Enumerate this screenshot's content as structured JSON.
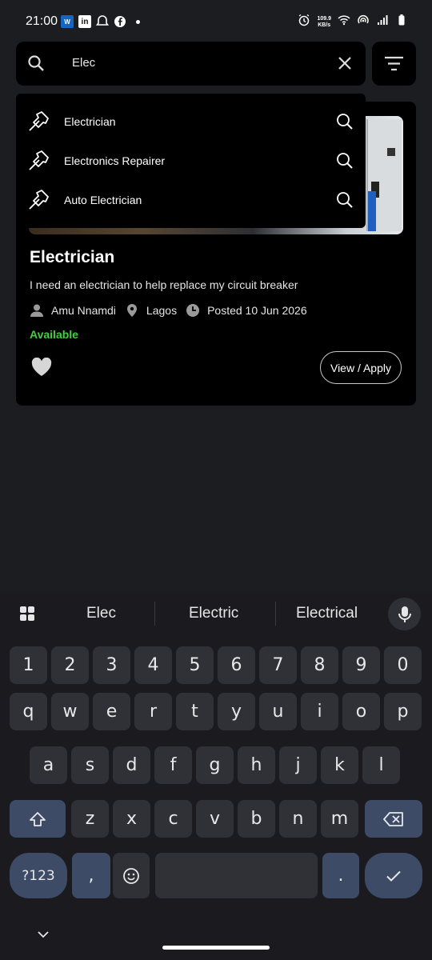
{
  "status_bar": {
    "time": "21:00",
    "speed_line1": "109.9",
    "speed_line2": "KB/s",
    "left_icons": [
      "w-app-icon",
      "linkedin-icon",
      "chat-bubble-icon",
      "facebook-icon"
    ],
    "right_icons": [
      "alarm-icon",
      "wifi-icon",
      "hotspot-icon",
      "signal-icon",
      "battery-icon"
    ]
  },
  "search": {
    "query": "Elec"
  },
  "suggestions": [
    {
      "label": "Electrician",
      "icon": "hammer-icon"
    },
    {
      "label": "Electronics Repairer",
      "icon": "hammer-icon"
    },
    {
      "label": "Auto Electrician",
      "icon": "hammer-icon"
    }
  ],
  "job_card": {
    "title": "Electrician",
    "description": "I need an electrician to help replace my circuit breaker",
    "poster": "Amu Nnamdi",
    "location": "Lagos",
    "posted": "Posted 10 Jun 2026",
    "status": "Available",
    "status_color": "#3fd13f",
    "action_label": "View / Apply"
  },
  "keyboard": {
    "suggestions": [
      "Elec",
      "Electric",
      "Electrical"
    ],
    "row_numbers": [
      "1",
      "2",
      "3",
      "4",
      "5",
      "6",
      "7",
      "8",
      "9",
      "0"
    ],
    "row1": [
      "q",
      "w",
      "e",
      "r",
      "t",
      "y",
      "u",
      "i",
      "o",
      "p"
    ],
    "row2": [
      "a",
      "s",
      "d",
      "f",
      "g",
      "h",
      "j",
      "k",
      "l"
    ],
    "row3": [
      "z",
      "x",
      "c",
      "v",
      "b",
      "n",
      "m"
    ],
    "symbols_label": "?123",
    "comma": ",",
    "period": "."
  },
  "colors": {
    "background": "#1c1d21",
    "card": "#000000",
    "key": "#2f3136",
    "key_accent": "#3d4b67"
  }
}
